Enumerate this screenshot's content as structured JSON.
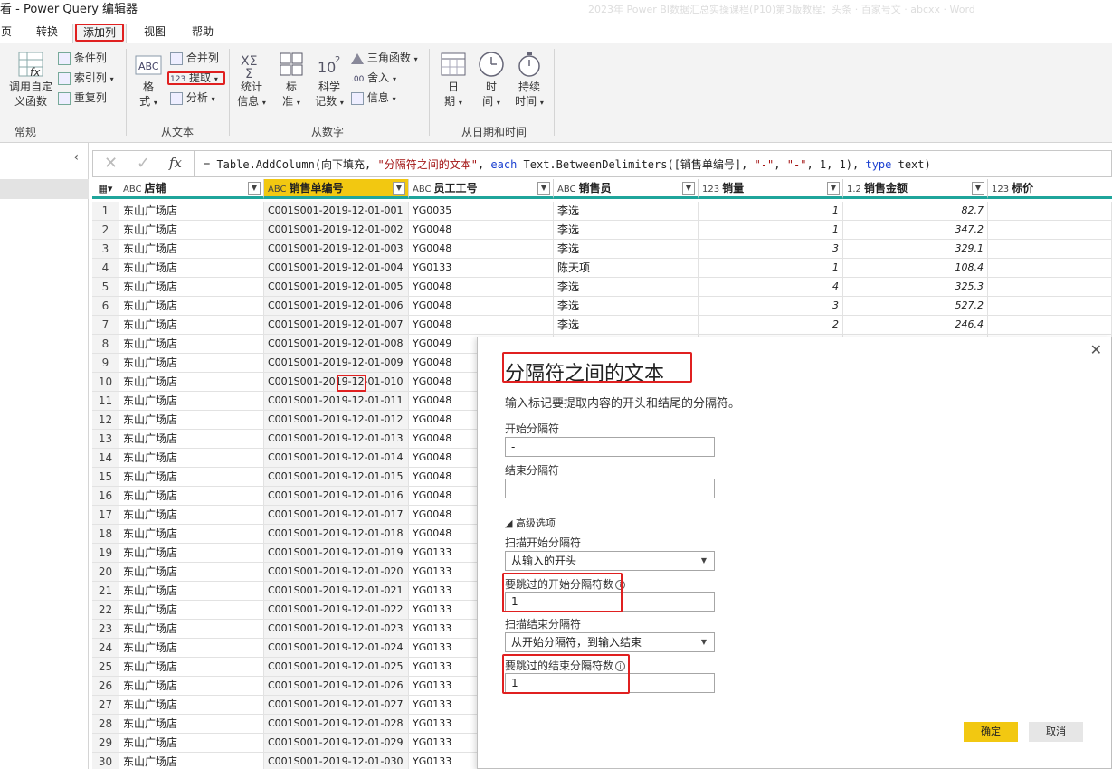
{
  "window": {
    "title": "看 - Power Query 编辑器",
    "title_right": "2023年 Power BI数据汇总实操课程(P10)第3版教程：头条 · 百家号文 · abcxx · Word"
  },
  "tabs": [
    {
      "label": "页"
    },
    {
      "label": "转换"
    },
    {
      "label": "添加列"
    },
    {
      "label": "视图"
    },
    {
      "label": "帮助"
    }
  ],
  "ribbon": {
    "general": {
      "invoke_custom_fn": "调用自定义函数",
      "invoke_custom_fn_line1": "调用自定",
      "invoke_custom_fn_line2": "义函数",
      "conditional_col": "条件列",
      "index_col": "索引列",
      "duplicate_col": "重复列",
      "group": "常规"
    },
    "from_text": {
      "format": "格式",
      "format_line1": "格",
      "format_line2": "式",
      "merge_cols": "合并列",
      "extract": "提取",
      "parse": "分析",
      "group": "从文本"
    },
    "from_number": {
      "stats_line1": "统计",
      "stats_line2": "信息",
      "standard_line1": "标",
      "standard_line2": "准",
      "scientific_line1": "科学",
      "scientific_line2": "记数",
      "trig": "三角函数",
      "rounding": "舍入",
      "info": "信息",
      "group": "从数字"
    },
    "from_datetime": {
      "date_line1": "日",
      "date_line2": "期",
      "time_line1": "时",
      "time_line2": "间",
      "duration_line1": "持续",
      "duration_line2": "时间",
      "group": "从日期和时间"
    }
  },
  "formula_bar": {
    "fx": "fx",
    "p1": "= Table.AddColumn(向下填充, ",
    "p2": "\"分隔符之间的文本\"",
    "p3": ", ",
    "p4": "each",
    "p5": " Text.BetweenDelimiters([销售单编号], ",
    "p6": "\"-\"",
    "p7": ", ",
    "p8": "\"-\"",
    "p9": ", 1, 1), ",
    "p10": "type",
    "p11": " text)"
  },
  "columns": [
    {
      "type": "ABC",
      "name": "店铺"
    },
    {
      "type": "ABC",
      "name": "销售单编号"
    },
    {
      "type": "ABC",
      "name": "员工工号"
    },
    {
      "type": "ABC",
      "name": "销售员"
    },
    {
      "type": "123",
      "name": "销量"
    },
    {
      "type": "1.2",
      "name": "销售金额"
    },
    {
      "type": "123",
      "name": "标价"
    }
  ],
  "rows": [
    {
      "idx": "1",
      "store": "东山广场店",
      "code": "C001S001-2019-12-01-001",
      "emp": "YG0035",
      "seller": "李选",
      "qty": "1",
      "amount": "82.7"
    },
    {
      "idx": "2",
      "store": "东山广场店",
      "code": "C001S001-2019-12-01-002",
      "emp": "YG0048",
      "seller": "李选",
      "qty": "1",
      "amount": "347.2"
    },
    {
      "idx": "3",
      "store": "东山广场店",
      "code": "C001S001-2019-12-01-003",
      "emp": "YG0048",
      "seller": "李选",
      "qty": "3",
      "amount": "329.1"
    },
    {
      "idx": "4",
      "store": "东山广场店",
      "code": "C001S001-2019-12-01-004",
      "emp": "YG0133",
      "seller": "陈天项",
      "qty": "1",
      "amount": "108.4"
    },
    {
      "idx": "5",
      "store": "东山广场店",
      "code": "C001S001-2019-12-01-005",
      "emp": "YG0048",
      "seller": "李选",
      "qty": "4",
      "amount": "325.3"
    },
    {
      "idx": "6",
      "store": "东山广场店",
      "code": "C001S001-2019-12-01-006",
      "emp": "YG0048",
      "seller": "李选",
      "qty": "3",
      "amount": "527.2"
    },
    {
      "idx": "7",
      "store": "东山广场店",
      "code": "C001S001-2019-12-01-007",
      "emp": "YG0048",
      "seller": "李选",
      "qty": "2",
      "amount": "246.4"
    },
    {
      "idx": "8",
      "store": "东山广场店",
      "code": "C001S001-2019-12-01-008",
      "emp": "YG0049"
    },
    {
      "idx": "9",
      "store": "东山广场店",
      "code": "C001S001-2019-12-01-009",
      "emp": "YG0048"
    },
    {
      "idx": "10",
      "store": "东山广场店",
      "code": "C001S001-2019-12-01-010",
      "emp": "YG0048"
    },
    {
      "idx": "11",
      "store": "东山广场店",
      "code": "C001S001-2019-12-01-011",
      "emp": "YG0048"
    },
    {
      "idx": "12",
      "store": "东山广场店",
      "code": "C001S001-2019-12-01-012",
      "emp": "YG0048"
    },
    {
      "idx": "13",
      "store": "东山广场店",
      "code": "C001S001-2019-12-01-013",
      "emp": "YG0048"
    },
    {
      "idx": "14",
      "store": "东山广场店",
      "code": "C001S001-2019-12-01-014",
      "emp": "YG0048"
    },
    {
      "idx": "15",
      "store": "东山广场店",
      "code": "C001S001-2019-12-01-015",
      "emp": "YG0048"
    },
    {
      "idx": "16",
      "store": "东山广场店",
      "code": "C001S001-2019-12-01-016",
      "emp": "YG0048"
    },
    {
      "idx": "17",
      "store": "东山广场店",
      "code": "C001S001-2019-12-01-017",
      "emp": "YG0048"
    },
    {
      "idx": "18",
      "store": "东山广场店",
      "code": "C001S001-2019-12-01-018",
      "emp": "YG0048"
    },
    {
      "idx": "19",
      "store": "东山广场店",
      "code": "C001S001-2019-12-01-019",
      "emp": "YG0133"
    },
    {
      "idx": "20",
      "store": "东山广场店",
      "code": "C001S001-2019-12-01-020",
      "emp": "YG0133"
    },
    {
      "idx": "21",
      "store": "东山广场店",
      "code": "C001S001-2019-12-01-021",
      "emp": "YG0133"
    },
    {
      "idx": "22",
      "store": "东山广场店",
      "code": "C001S001-2019-12-01-022",
      "emp": "YG0133"
    },
    {
      "idx": "23",
      "store": "东山广场店",
      "code": "C001S001-2019-12-01-023",
      "emp": "YG0133"
    },
    {
      "idx": "24",
      "store": "东山广场店",
      "code": "C001S001-2019-12-01-024",
      "emp": "YG0133"
    },
    {
      "idx": "25",
      "store": "东山广场店",
      "code": "C001S001-2019-12-01-025",
      "emp": "YG0133"
    },
    {
      "idx": "26",
      "store": "东山广场店",
      "code": "C001S001-2019-12-01-026",
      "emp": "YG0133"
    },
    {
      "idx": "27",
      "store": "东山广场店",
      "code": "C001S001-2019-12-01-027",
      "emp": "YG0133"
    },
    {
      "idx": "28",
      "store": "东山广场店",
      "code": "C001S001-2019-12-01-028",
      "emp": "YG0133"
    },
    {
      "idx": "29",
      "store": "东山广场店",
      "code": "C001S001-2019-12-01-029",
      "emp": "YG0133"
    },
    {
      "idx": "30",
      "store": "东山广场店",
      "code": "C001S001-2019-12-01-030",
      "emp": "YG0133"
    }
  ],
  "dialog": {
    "title": "分隔符之间的文本",
    "description": "输入标记要提取内容的开头和结尾的分隔符。",
    "start_label": "开始分隔符",
    "start_value": "-",
    "end_label": "结束分隔符",
    "end_value": "-",
    "advanced": "◢ 高级选项",
    "scan_start_label": "扫描开始分隔符",
    "scan_start_value": "从输入的开头",
    "skip_start_label": "要跳过的开始分隔符数",
    "skip_start_value": "1",
    "scan_end_label": "扫描结束分隔符",
    "scan_end_value": "从开始分隔符，到输入结束",
    "skip_end_label": "要跳过的结束分隔符数",
    "skip_end_value": "1",
    "ok": "确定",
    "cancel": "取消"
  },
  "colors": {
    "accent_yellow": "#f2c811",
    "header_underline": "#1fa59b",
    "annotation_red": "#e02020"
  }
}
